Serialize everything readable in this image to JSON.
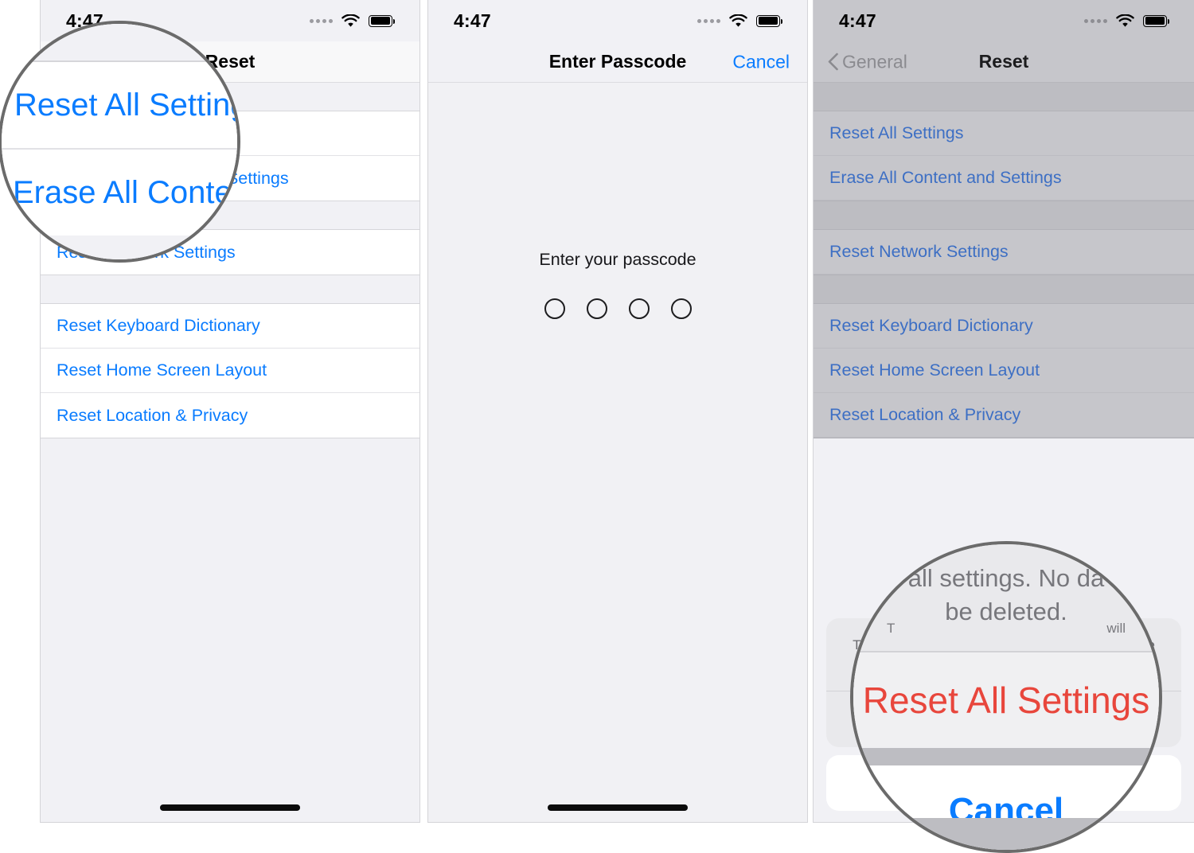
{
  "status_bar": {
    "time": "4:47",
    "icons": [
      "signal-dots-icon",
      "wifi-icon",
      "battery-icon"
    ]
  },
  "colors": {
    "accent_blue": "#0a7cff",
    "destructive_red": "#e8463c",
    "list_background": "#f1f1f5",
    "dim_overlay": "#bdbdc2"
  },
  "panel1": {
    "nav": {
      "title": "Reset"
    },
    "rows_group1": [
      {
        "label": "Reset All Settings"
      },
      {
        "label": "Erase All Content and Settings"
      }
    ],
    "rows_group2": [
      {
        "label": "Reset Network Settings"
      }
    ],
    "rows_group3": [
      {
        "label": "Reset Keyboard Dictionary"
      },
      {
        "label": "Reset Home Screen Layout"
      },
      {
        "label": "Reset Location & Privacy"
      }
    ],
    "magnifier": {
      "row_a": "Reset All Settings",
      "row_b": "Erase All Content and Settings"
    }
  },
  "panel2": {
    "nav": {
      "title": "Enter Passcode",
      "cancel_label": "Cancel"
    },
    "prompt": "Enter your passcode",
    "passcode_dots": 4
  },
  "panel3": {
    "nav": {
      "back_label": "General",
      "title": "Reset"
    },
    "rows_group1": [
      {
        "label": "Reset All Settings"
      },
      {
        "label": "Erase All Content and Settings"
      }
    ],
    "rows_group2": [
      {
        "label": "Reset Network Settings"
      }
    ],
    "rows_group3": [
      {
        "label": "Reset Keyboard Dictionary"
      },
      {
        "label": "Reset Home Screen Layout"
      },
      {
        "label": "Reset Location & Privacy"
      }
    ],
    "action_sheet": {
      "message": "This will reset all settings. No data or media will be deleted.",
      "destructive_label": "Reset All Settings",
      "cancel_label": "Cancel"
    },
    "magnifier": {
      "message_line1": "all settings. No da",
      "message_line2": "be deleted.",
      "partial_left": "T",
      "partial_right": "will",
      "destructive_label": "Reset All Settings",
      "cancel_label": "Cancel"
    }
  }
}
